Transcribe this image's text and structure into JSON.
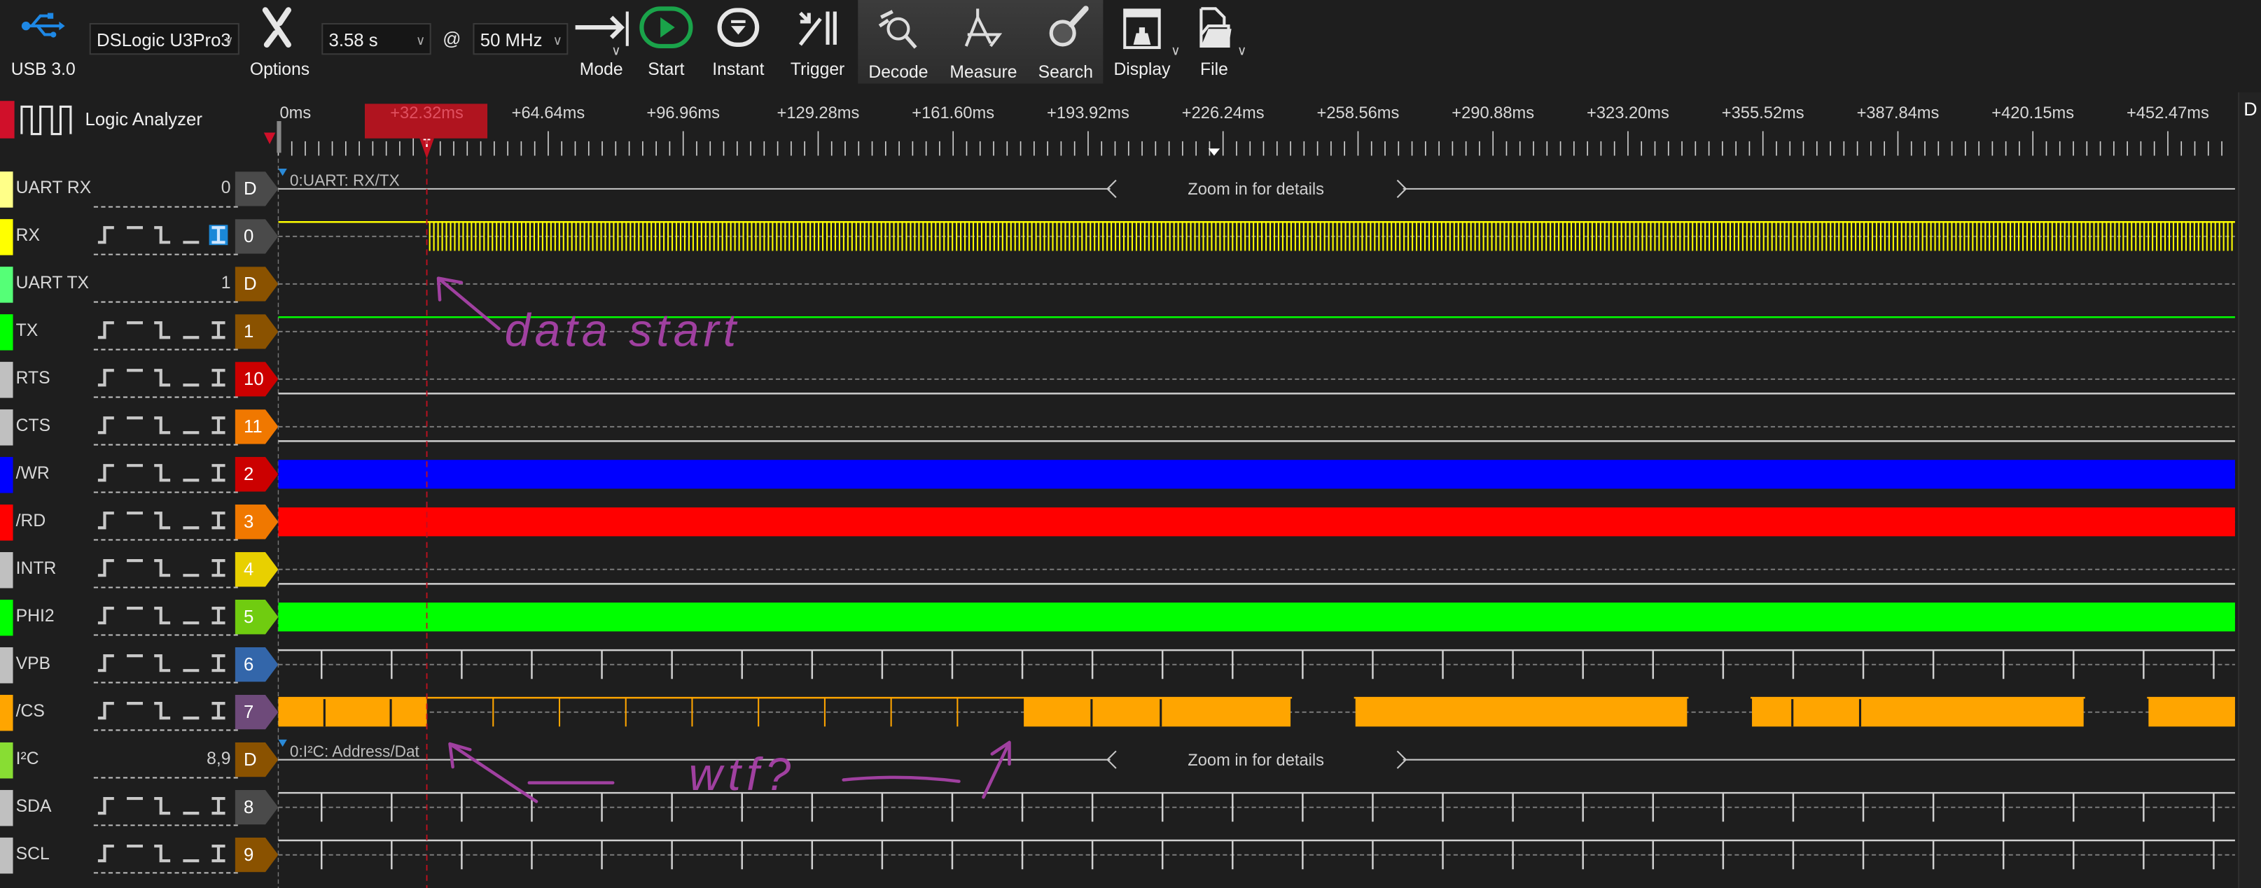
{
  "toolbar": {
    "usb_label": "USB 3.0",
    "device": "DSLogic U3Pro3",
    "options_label": "Options",
    "duration": "3.58 s",
    "at": "@",
    "sample_rate": "50 MHz",
    "mode_label": "Mode",
    "start_label": "Start",
    "instant_label": "Instant",
    "trigger_label": "Trigger",
    "decode_label": "Decode",
    "measure_label": "Measure",
    "search_label": "Search",
    "display_label": "Display",
    "file_label": "File",
    "accent_start": "#1aa34a",
    "accent_usb": "#1e88e5"
  },
  "header": {
    "title": "Logic Analyzer",
    "right_panel_label": "D"
  },
  "ruler": {
    "labels": [
      "0ms",
      "+32.32ms",
      "+64.64ms",
      "+96.96ms",
      "+129.28ms",
      "+161.60ms",
      "+193.92ms",
      "+226.24ms",
      "+258.56ms",
      "+290.88ms",
      "+323.20ms",
      "+355.52ms",
      "+387.84ms",
      "+420.15ms",
      "+452.47ms"
    ],
    "trigger_marker": "T",
    "trigger_color": "#b0141f"
  },
  "channels": [
    {
      "name": "UART RX",
      "kind": "decoder",
      "value": "0",
      "tag": "D",
      "strip": "#ffff88",
      "tag_color": "#4a4a4a",
      "wave": "decoder",
      "decoder_label": "0:UART: RX/TX",
      "zoom_hint": "Zoom in for details"
    },
    {
      "name": "RX",
      "kind": "signal",
      "tag": "0",
      "strip": "#ffff00",
      "tag_color": "#4a4a4a",
      "wave": "dense",
      "wave_color": "#ffff00",
      "trigger_selected": 4
    },
    {
      "name": "UART TX",
      "kind": "decoder",
      "value": "1",
      "tag": "D",
      "strip": "#55ff77",
      "tag_color": "#8a5200",
      "wave": "none"
    },
    {
      "name": "TX",
      "kind": "signal",
      "tag": "1",
      "strip": "#00ff00",
      "tag_color": "#8a5200",
      "wave": "high",
      "wave_color": "#00ff00"
    },
    {
      "name": "RTS",
      "kind": "signal",
      "tag": "10",
      "strip": "#c0c0c0",
      "tag_color": "#cc0000",
      "wave": "low",
      "wave_color": "#cfcfcf"
    },
    {
      "name": "CTS",
      "kind": "signal",
      "tag": "11",
      "strip": "#c0c0c0",
      "tag_color": "#f07800",
      "wave": "low",
      "wave_color": "#cfcfcf"
    },
    {
      "name": "/WR",
      "kind": "signal",
      "tag": "2",
      "strip": "#0000ff",
      "tag_color": "#cc0000",
      "wave": "block",
      "wave_color": "#0000ff"
    },
    {
      "name": "/RD",
      "kind": "signal",
      "tag": "3",
      "strip": "#ff0000",
      "tag_color": "#f07800",
      "wave": "block",
      "wave_color": "#ff0000"
    },
    {
      "name": "INTR",
      "kind": "signal",
      "tag": "4",
      "strip": "#c0c0c0",
      "tag_color": "#e8d000",
      "wave": "low",
      "wave_color": "#cfcfcf"
    },
    {
      "name": "PHI2",
      "kind": "signal",
      "tag": "5",
      "strip": "#00ff00",
      "tag_color": "#70cc10",
      "wave": "block",
      "wave_color": "#00ff00"
    },
    {
      "name": "VPB",
      "kind": "signal",
      "tag": "6",
      "strip": "#c0c0c0",
      "tag_color": "#3366aa",
      "wave": "ticks",
      "wave_color": "#d0d0d0"
    },
    {
      "name": "/CS",
      "kind": "signal",
      "tag": "7",
      "strip": "#ffa500",
      "tag_color": "#6e4a7a",
      "wave": "cs",
      "wave_color": "#ffa500"
    },
    {
      "name": "I²C",
      "kind": "decoder",
      "value": "8,9",
      "tag": "D",
      "strip": "#88dd33",
      "tag_color": "#8a5200",
      "wave": "decoder",
      "decoder_label": "0:I²C: Address/Dat",
      "zoom_hint": "Zoom in for details"
    },
    {
      "name": "SDA",
      "kind": "signal",
      "tag": "8",
      "strip": "#c0c0c0",
      "tag_color": "#4a4a4a",
      "wave": "ticks",
      "wave_color": "#d0d0d0"
    },
    {
      "name": "SCL",
      "kind": "signal",
      "tag": "9",
      "strip": "#c0c0c0",
      "tag_color": "#8a5200",
      "wave": "ticks",
      "wave_color": "#d0d0d0"
    }
  ],
  "trigger_icons": [
    "rising-edge-icon",
    "high-level-icon",
    "falling-edge-icon",
    "low-level-icon",
    "any-edge-icon"
  ],
  "annotations": {
    "color": "#a040a0",
    "data_start": "data start",
    "wtf": "wtf?"
  }
}
